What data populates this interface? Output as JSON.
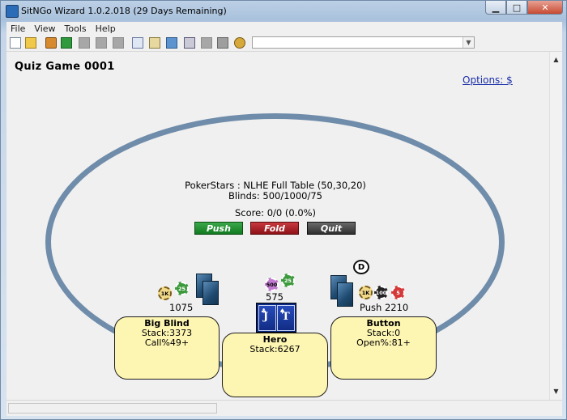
{
  "window": {
    "title": "SitNGo Wizard 1.0.2.018 (29 Days Remaining)",
    "minimize_glyph": "▁",
    "maximize_glyph": "□",
    "close_glyph": "✕"
  },
  "menu": [
    "File",
    "View",
    "Tools",
    "Help"
  ],
  "toolbar": {
    "icons": [
      "new-file-icon",
      "open-folder-icon",
      "home-icon",
      "refresh-icon",
      "disabled-icon",
      "disabled-icon",
      "disabled-icon",
      "copy-icon",
      "paste-icon",
      "image-icon",
      "calculator-icon",
      "disabled-icon",
      "note-icon",
      "settings-gear-icon"
    ],
    "combo_value": ""
  },
  "game": {
    "title": "Quiz Game 0001",
    "options_link": "Options: $",
    "table_info": "PokerStars : NLHE Full Table (50,30,20)",
    "blinds": "Blinds: 500/1000/75",
    "score": "Score: 0/0 (0.0%)"
  },
  "buttons": {
    "push": "Push",
    "fold": "Fold",
    "quit": "Quit"
  },
  "dealer_label": "D",
  "seats": {
    "big_blind": {
      "name": "Big Blind",
      "stack": "Stack:3373",
      "stat": "Call%49+",
      "bet": "1075",
      "chips": [
        "1K",
        "25"
      ]
    },
    "hero": {
      "name": "Hero",
      "stack": "Stack:6267",
      "bet": "575",
      "chips": [
        "500",
        "25"
      ]
    },
    "button": {
      "name": "Button",
      "stack": "Stack:0",
      "stat": "Open%:81+",
      "bet": "Push 2210",
      "chips": [
        "1K",
        "100",
        "5"
      ]
    }
  },
  "hero_cards": [
    {
      "rank": "J",
      "suit": "♣"
    },
    {
      "rank": "T",
      "suit": "♠"
    }
  ],
  "colors": {
    "table_rail": "#6f8caa",
    "seat_fill": "#fdf5b2",
    "push": "#1f8f30",
    "fold": "#a8222a",
    "quit": "#454545"
  }
}
